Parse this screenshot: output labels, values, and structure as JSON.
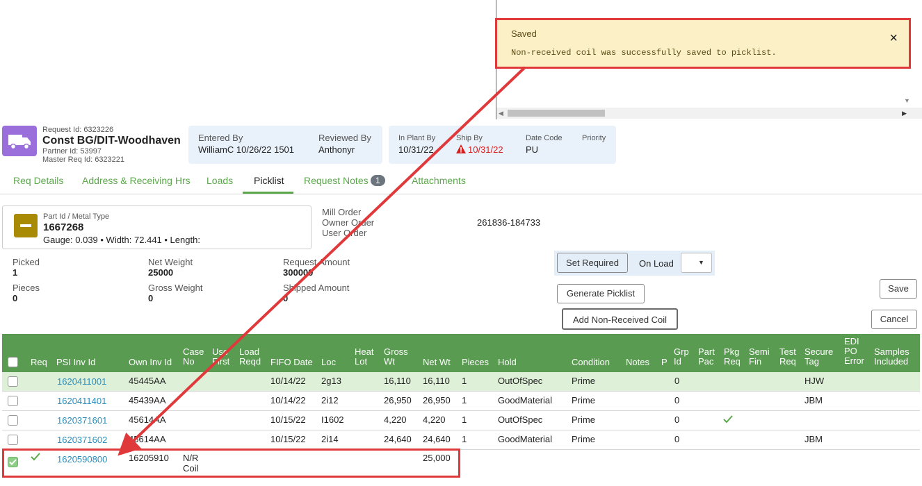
{
  "toast": {
    "title": "Saved",
    "message": "Non-received coil was successfully saved to picklist.",
    "close": "×"
  },
  "header": {
    "request_id": "Request Id: 6323226",
    "title": "Const BG/DIT-Woodhaven",
    "partner_id": "Partner Id: 53997",
    "master_req_id": "Master Req Id: 6323221",
    "entered_by_label": "Entered By",
    "entered_by_value": "WilliamC 10/26/22 1501",
    "reviewed_by_label": "Reviewed By",
    "reviewed_by_value": "Anthonyr",
    "in_plant_by_label": "In Plant By",
    "in_plant_by_value": "10/31/22",
    "ship_by_label": "Ship By",
    "ship_by_value": "10/31/22",
    "date_code_label": "Date Code",
    "date_code_value": "PU",
    "priority_label": "Priority"
  },
  "tabs": [
    {
      "label": "Req Details"
    },
    {
      "label": "Address & Receiving Hrs"
    },
    {
      "label": "Loads"
    },
    {
      "label": "Picklist"
    },
    {
      "label": "Request Notes",
      "badge": "1"
    },
    {
      "label": "Attachments"
    }
  ],
  "part": {
    "label": "Part Id / Metal Type",
    "id": "1667268",
    "specs": "Gauge: 0.039 • Width: 72.441 • Length:"
  },
  "orders": {
    "mill_order": "Mill Order",
    "owner_order": "Owner Order",
    "user_order": "User Order",
    "order_value": "261836-184733"
  },
  "stats": {
    "picked_label": "Picked",
    "picked_value": "1",
    "pieces_label": "Pieces",
    "pieces_value": "0",
    "net_weight_label": "Net Weight",
    "net_weight_value": "25000",
    "gross_weight_label": "Gross Weight",
    "gross_weight_value": "0",
    "request_amount_label": "Request Amount",
    "request_amount_value": "300000",
    "shipped_amount_label": "Shipped Amount",
    "shipped_amount_value": "0"
  },
  "buttons": {
    "set_required": "Set Required",
    "on_load": "On Load",
    "generate_picklist": "Generate Picklist",
    "add_non_received": "Add Non-Received Coil",
    "save": "Save",
    "cancel": "Cancel"
  },
  "table": {
    "headers": {
      "req": "Req",
      "psi_inv_id": "PSI Inv Id",
      "own_inv_id": "Own Inv Id",
      "case_no_1": "Case",
      "case_no_2": "No",
      "use_first_1": "Use",
      "use_first_2": "First",
      "load_reqd_1": "Load",
      "load_reqd_2": "Reqd",
      "fifo_date": "FIFO Date",
      "loc": "Loc",
      "heat_lot_1": "Heat",
      "heat_lot_2": "Lot",
      "gross_wt_1": "Gross",
      "gross_wt_2": "Wt",
      "net_wt": "Net Wt",
      "pieces": "Pieces",
      "hold": "Hold",
      "condition": "Condition",
      "notes": "Notes",
      "p": "P",
      "grp_id_1": "Grp",
      "grp_id_2": "Id",
      "part_pac_1": "Part",
      "part_pac_2": "Pac",
      "pkg_req_1": "Pkg",
      "pkg_req_2": "Req",
      "semi_fin_1": "Semi",
      "semi_fin_2": "Fin",
      "test_req_1": "Test",
      "test_req_2": "Req",
      "secure_tag_1": "Secure",
      "secure_tag_2": "Tag",
      "edi_po_error_1": "EDI",
      "edi_po_error_2": "PO",
      "edi_po_error_3": "Error",
      "samples_1": "Samples",
      "samples_2": "Included"
    },
    "rows": [
      {
        "psi": "1620411001",
        "own": "45445AA",
        "fifo": "10/14/22",
        "loc": "2g13",
        "gross": "16,110",
        "net": "16,110",
        "pieces": "1",
        "hold": "OutOfSpec",
        "condition": "Prime",
        "grp": "0",
        "secure": "HJW"
      },
      {
        "psi": "1620411401",
        "own": "45439AA",
        "fifo": "10/14/22",
        "loc": "2i12",
        "gross": "26,950",
        "net": "26,950",
        "pieces": "1",
        "hold": "GoodMaterial",
        "condition": "Prime",
        "grp": "0",
        "secure": "JBM"
      },
      {
        "psi": "1620371601",
        "own": "45614AA",
        "fifo": "10/15/22",
        "loc": "I1602",
        "gross": "4,220",
        "net": "4,220",
        "pieces": "1",
        "hold": "OutOfSpec",
        "condition": "Prime",
        "grp": "0",
        "secure": ""
      },
      {
        "psi": "1620371602",
        "own": "45614AA",
        "fifo": "10/15/22",
        "loc": "2i14",
        "gross": "24,640",
        "net": "24,640",
        "pieces": "1",
        "hold": "GoodMaterial",
        "condition": "Prime",
        "grp": "0",
        "secure": "JBM"
      },
      {
        "psi": "1620590800",
        "own": "16205910",
        "case_1": "N/R",
        "case_2": "Coil",
        "net": "25,000"
      }
    ]
  },
  "colors": {
    "accent_green": "#5a9b52",
    "highlight_red": "#e0393b",
    "toast_bg": "#fcf0c6",
    "truck_purple": "#9a6fdc"
  }
}
